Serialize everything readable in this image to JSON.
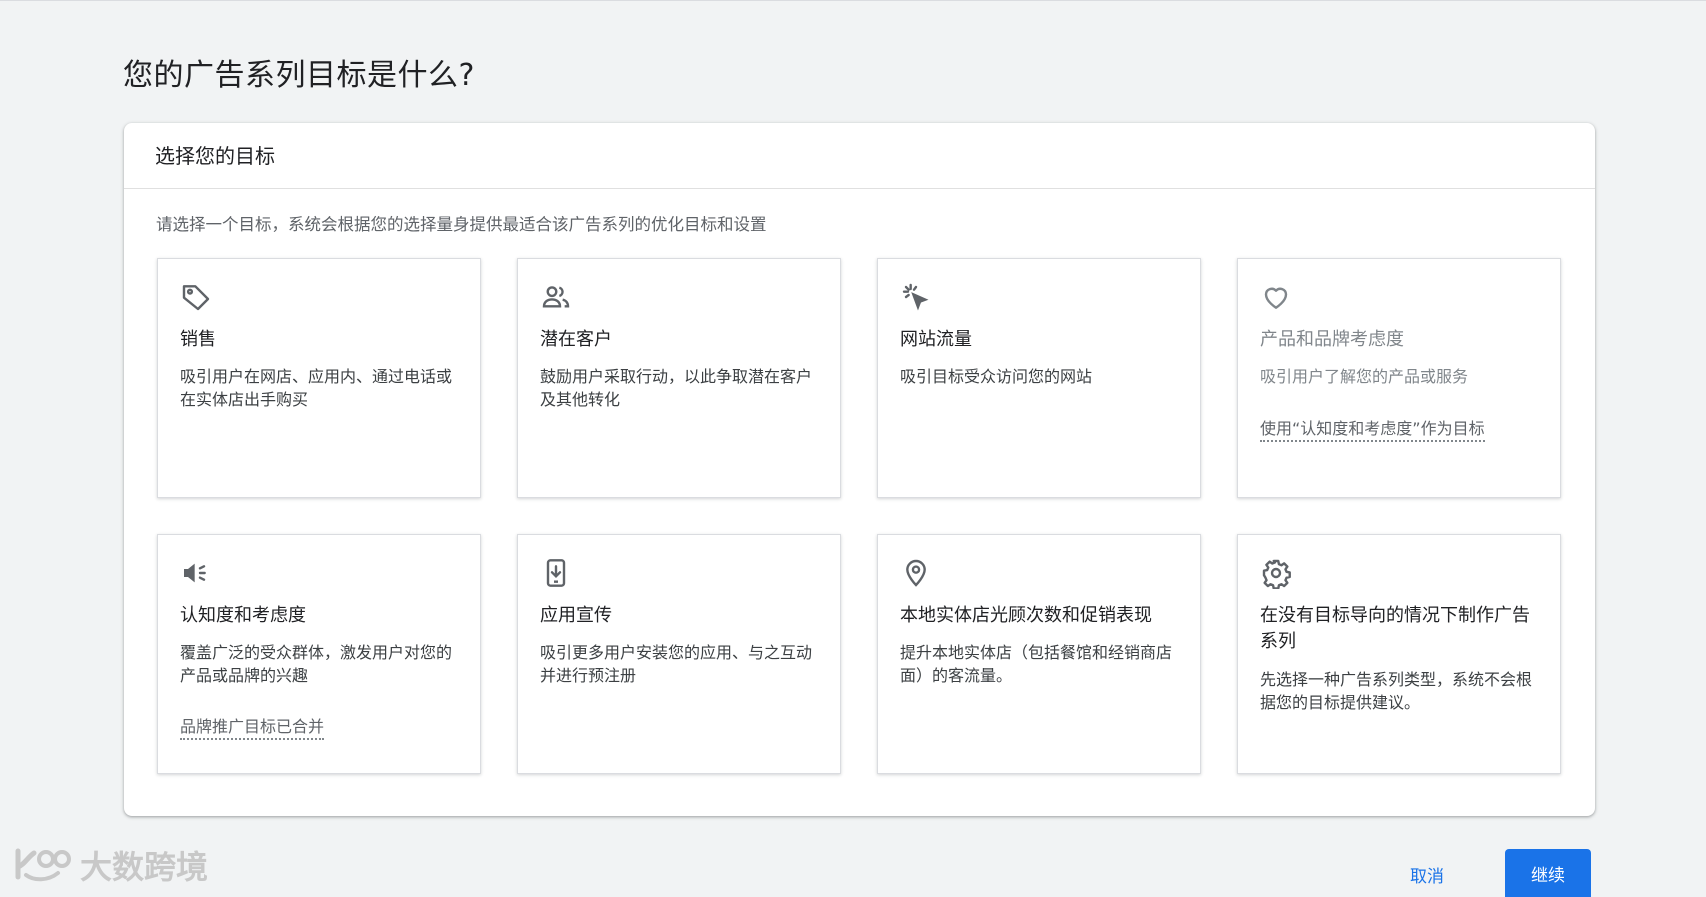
{
  "page": {
    "title": "您的广告系列目标是什么?"
  },
  "panel": {
    "title": "选择您的目标",
    "description": "请选择一个目标，系统会根据您的选择量身提供最适合该广告系列的优化目标和设置"
  },
  "goals": [
    {
      "icon": "tag-icon",
      "title": "销售",
      "description": "吸引用户在网店、应用内、通过电话或在实体店出手购买"
    },
    {
      "icon": "people-icon",
      "title": "潜在客户",
      "description": "鼓励用户采取行动，以此争取潜在客户及其他转化"
    },
    {
      "icon": "cursor-click-icon",
      "title": "网站流量",
      "description": "吸引目标受众访问您的网站"
    },
    {
      "icon": "heart-icon",
      "title": "产品和品牌考虑度",
      "description": "吸引用户了解您的产品或服务",
      "link": "使用“认知度和考虑度”作为目标",
      "disabled": true
    },
    {
      "icon": "megaphone-icon",
      "title": "认知度和考虑度",
      "description": "覆盖广泛的受众群体，激发用户对您的产品或品牌的兴趣",
      "link": "品牌推广目标已合并"
    },
    {
      "icon": "mobile-download-icon",
      "title": "应用宣传",
      "description": "吸引更多用户安装您的应用、与之互动并进行预注册"
    },
    {
      "icon": "location-pin-icon",
      "title": "本地实体店光顾次数和促销表现",
      "description": "提升本地实体店（包括餐馆和经销商店面）的客流量。"
    },
    {
      "icon": "gear-icon",
      "title": "在没有目标导向的情况下制作广告系列",
      "description": "先选择一种广告系列类型，系统不会根据您的目标提供建议。"
    }
  ],
  "watermark": {
    "text": "大数跨境"
  },
  "footer": {
    "cancel_label": "取消",
    "continue_label": "继续"
  },
  "colors": {
    "accent": "#1a73e8",
    "background": "#f1f3f4"
  }
}
